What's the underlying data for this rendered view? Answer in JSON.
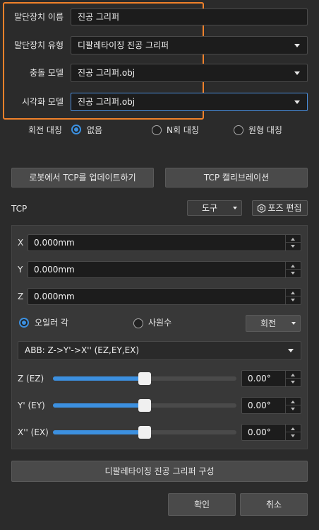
{
  "form": {
    "name_label": "말단장치 이름",
    "name_value": "진공 그리퍼",
    "type_label": "말단장치 유형",
    "type_value": "디팔레타이징 진공 그리퍼",
    "collision_label": "충돌 모델",
    "collision_value": "진공 그리퍼.obj",
    "visual_label": "시각화 모델",
    "visual_value": "진공 그리퍼.obj"
  },
  "symmetry": {
    "label": "회전 대칭",
    "options": [
      "없음",
      "N회 대칭",
      "원형 대칭"
    ],
    "selected": "없음"
  },
  "actions": {
    "update_tcp": "로봇에서 TCP를 업데이트하기",
    "calibrate_tcp": "TCP 캘리브레이션"
  },
  "tcp": {
    "label": "TCP",
    "frame_value": "도구",
    "pose_edit": "포즈 편집",
    "x_label": "X",
    "x_value": "0.000mm",
    "y_label": "Y",
    "y_value": "0.000mm",
    "z_label": "Z",
    "z_value": "0.000mm",
    "mode_euler": "오일러 각",
    "mode_quat": "사원수",
    "mode_selected": "오일러 각",
    "rotation_value": "회전",
    "convention": "ABB: Z->Y'->X'' (EZ,EY,EX)",
    "sliders": [
      {
        "label": "Z (EZ)",
        "value": "0.00°",
        "level": 0.5
      },
      {
        "label": "Y' (EY)",
        "value": "0.00°",
        "level": 0.5
      },
      {
        "label": "X'' (EX)",
        "value": "0.00°",
        "level": 0.5
      }
    ]
  },
  "footer": {
    "configure": "디팔레타이징 진공 그리퍼 구성",
    "ok": "확인",
    "cancel": "취소"
  },
  "colors": {
    "accent": "#3c90e0",
    "highlight": "#f0812a",
    "background": "#2b2b2b"
  }
}
